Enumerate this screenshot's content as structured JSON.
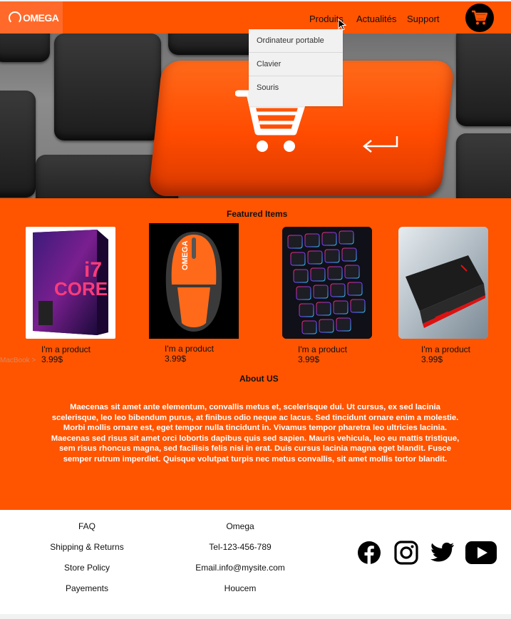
{
  "header": {
    "logo_text": "OMEGA",
    "nav": [
      "Produits",
      "Actualités",
      "Support"
    ],
    "cart_icon": "shopping-cart-icon",
    "accent_color": "#ff5400"
  },
  "dropdown": {
    "items": [
      "Ordinateur portable",
      "Clavier",
      "Souris"
    ]
  },
  "featured": {
    "title": "Featured Items",
    "products": [
      {
        "name": "I'm a product",
        "price": "3.99$",
        "image": "intel-core-i7-box"
      },
      {
        "name": "I'm a product",
        "price": "3.99$",
        "image": "orange-gaming-mouse"
      },
      {
        "name": "I'm a product",
        "price": "3.99$",
        "image": "rgb-keyboard"
      },
      {
        "name": "I'm a product",
        "price": "3.99$",
        "image": "gaming-laptop"
      }
    ],
    "stray_label": "MacBook >"
  },
  "about": {
    "title": "About US",
    "text": "Maecenas sit amet ante elementum, convallis metus et, scelerisque dui. Ut cursus, ex sed lacinia scelerisque, leo leo bibendum purus, at finibus odio neque ac lacus. Sed tincidunt ornare enim a molestie. Morbi mollis ornare est, eget tempor nulla tincidunt in. Vivamus tempor pharetra leo ultricies lacinia. Maecenas sed risus sit amet orci lobortis dapibus quis sed sapien. Mauris vehicula, leo eu mattis tristique, sem risus rhoncus magna, sed facilisis felis nisi in erat. Duis cursus lacinia magna eget blandit. Fusce semper rutrum imperdiet. Quisque volutpat turpis nec metus convallis, sit amet mollis tortor blandit."
  },
  "footer": {
    "col1": [
      "FAQ",
      "Shipping & Returns",
      "Store Policy",
      "Payements"
    ],
    "col2": [
      "Omega",
      "Tel-123-456-789",
      "Email.info@mysite.com",
      "Houcem"
    ],
    "social_icons": [
      "facebook-icon",
      "instagram-icon",
      "twitter-icon",
      "youtube-icon"
    ]
  }
}
